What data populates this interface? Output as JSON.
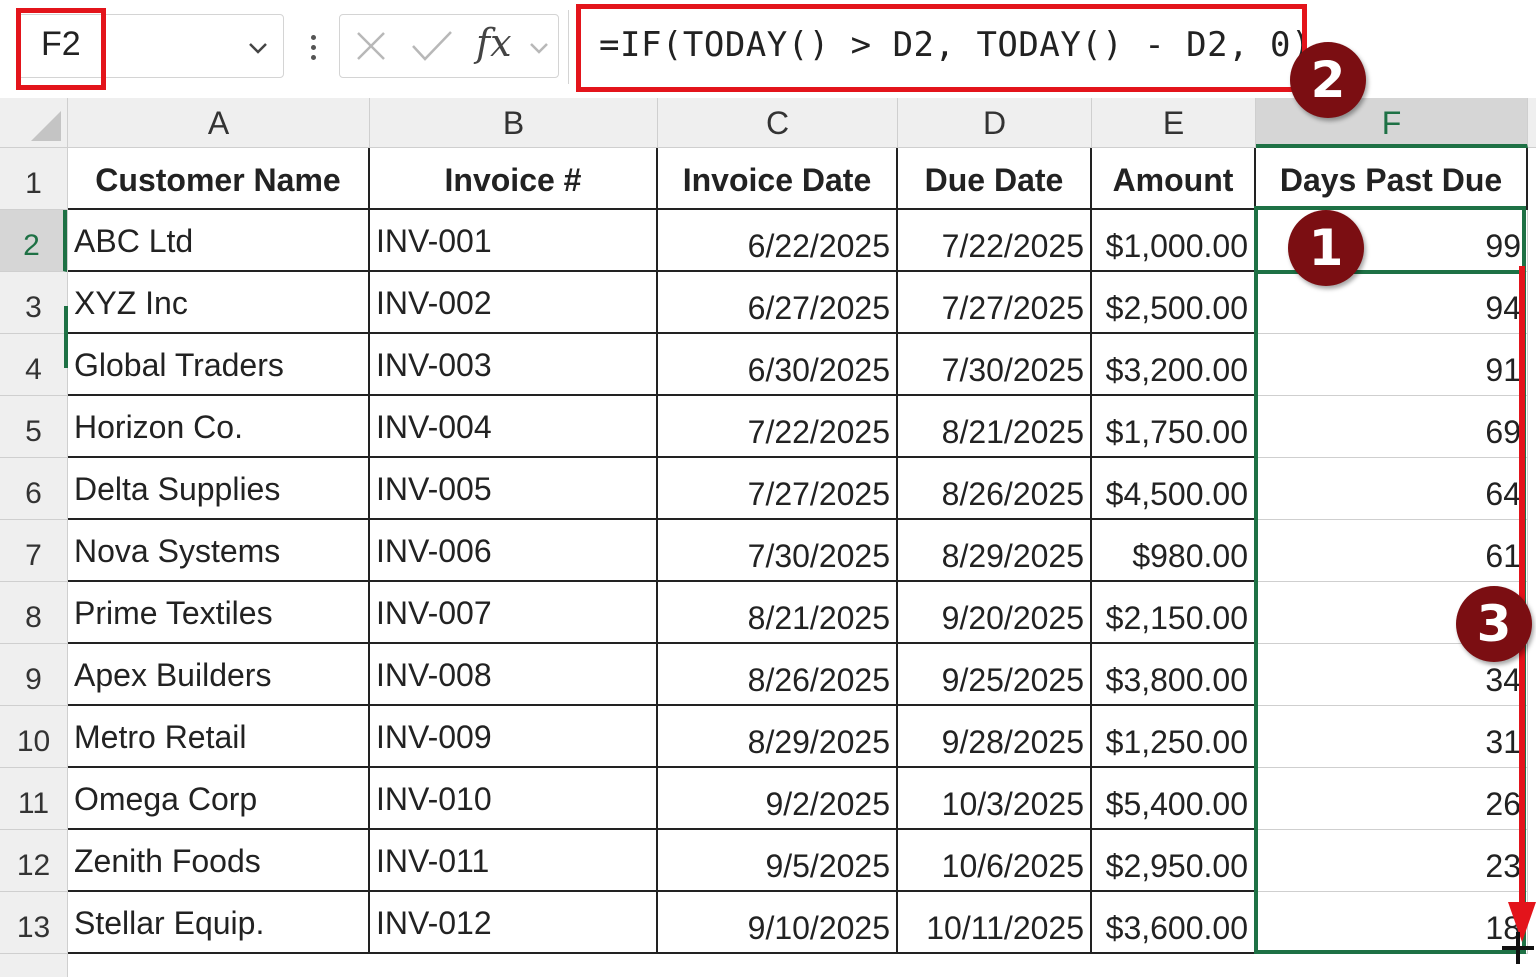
{
  "formula_bar": {
    "name_box": "F2",
    "fx_label": "fx",
    "formula": "=IF(TODAY() > D2, TODAY() - D2, 0)"
  },
  "annotations": {
    "step1": "1",
    "step2": "2",
    "step3": "3",
    "highlight_color": "#e3141b",
    "badge_color": "#7b0e12"
  },
  "sheet": {
    "columns": [
      "A",
      "B",
      "C",
      "D",
      "E",
      "F"
    ],
    "row_numbers": [
      "1",
      "2",
      "3",
      "4",
      "5",
      "6",
      "7",
      "8",
      "9",
      "10",
      "11",
      "12",
      "13"
    ],
    "headers": [
      "Customer Name",
      "Invoice #",
      "Invoice Date",
      "Due Date",
      "Amount",
      "Days Past Due"
    ],
    "rows": [
      [
        "ABC Ltd",
        "INV-001",
        "6/22/2025",
        "7/22/2025",
        "$1,000.00",
        "99"
      ],
      [
        "XYZ Inc",
        "INV-002",
        "6/27/2025",
        "7/27/2025",
        "$2,500.00",
        "94"
      ],
      [
        "Global Traders",
        "INV-003",
        "6/30/2025",
        "7/30/2025",
        "$3,200.00",
        "91"
      ],
      [
        "Horizon Co.",
        "INV-004",
        "7/22/2025",
        "8/21/2025",
        "$1,750.00",
        "69"
      ],
      [
        "Delta Supplies",
        "INV-005",
        "7/27/2025",
        "8/26/2025",
        "$4,500.00",
        "64"
      ],
      [
        "Nova Systems",
        "INV-006",
        "7/30/2025",
        "8/29/2025",
        "$980.00",
        "61"
      ],
      [
        "Prime Textiles",
        "INV-007",
        "8/21/2025",
        "9/20/2025",
        "$2,150.00",
        ""
      ],
      [
        "Apex Builders",
        "INV-008",
        "8/26/2025",
        "9/25/2025",
        "$3,800.00",
        "34"
      ],
      [
        "Metro Retail",
        "INV-009",
        "8/29/2025",
        "9/28/2025",
        "$1,250.00",
        "31"
      ],
      [
        "Omega Corp",
        "INV-010",
        "9/2/2025",
        "10/3/2025",
        "$5,400.00",
        "26"
      ],
      [
        "Zenith Foods",
        "INV-011",
        "9/5/2025",
        "10/6/2025",
        "$2,950.00",
        "23"
      ],
      [
        "Stellar Equip.",
        "INV-012",
        "9/10/2025",
        "10/11/2025",
        "$3,600.00",
        "18"
      ]
    ],
    "accent_color": "#1e7145"
  }
}
